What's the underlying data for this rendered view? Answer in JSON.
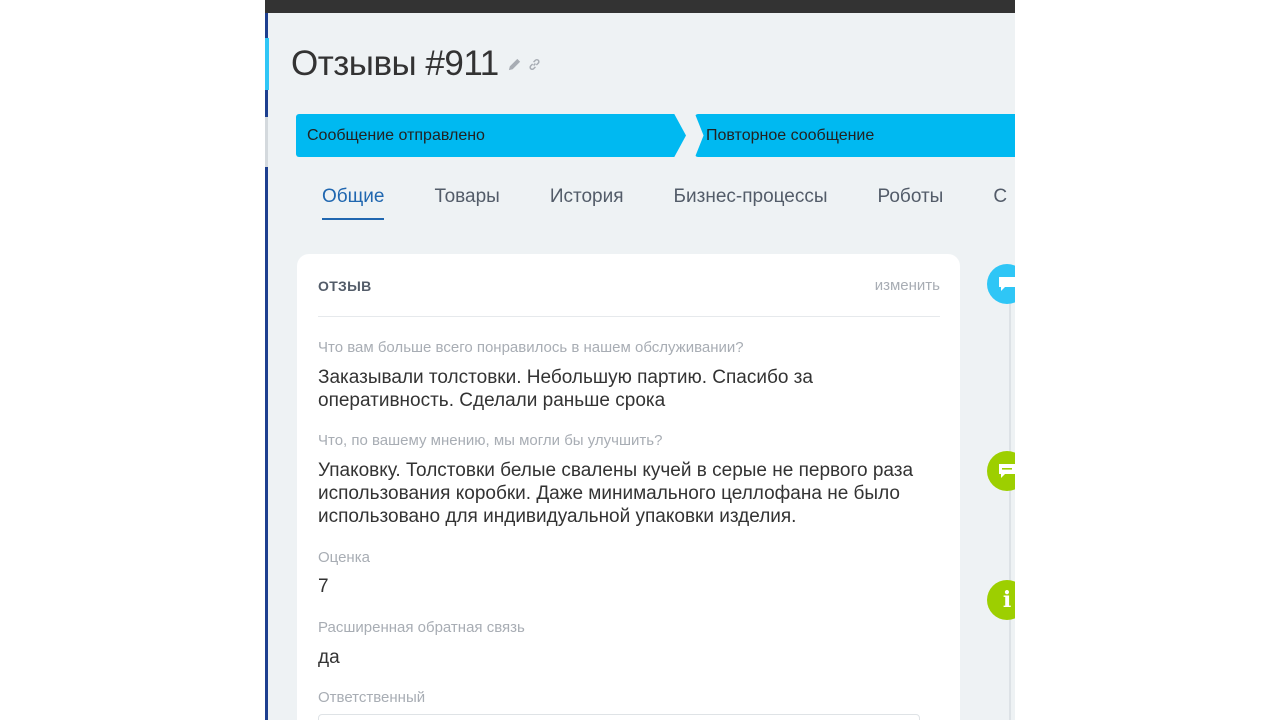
{
  "page": {
    "title": "Отзывы #911"
  },
  "stages": [
    {
      "label": "Сообщение отправлено"
    },
    {
      "label": "Повторное сообщение"
    }
  ],
  "tabs": [
    {
      "label": "Общие",
      "active": true
    },
    {
      "label": "Товары",
      "active": false
    },
    {
      "label": "История",
      "active": false
    },
    {
      "label": "Бизнес-процессы",
      "active": false
    },
    {
      "label": "Роботы",
      "active": false
    },
    {
      "label": "С",
      "active": false
    }
  ],
  "card": {
    "header": "ОТЗЫВ",
    "edit_label": "изменить",
    "fields": [
      {
        "label": "Что вам больше всего понравилось в нашем обслуживании?",
        "value": "Заказывали толстовки. Небольшую партию. Спасибо за оперативность. Сделали раньше срока"
      },
      {
        "label": "Что, по вашему мнению, мы могли бы улучшить?",
        "value": "Упаковку. Толстовки белые свалены кучей в серые не первого раза использования коробки. Даже минимального целлофана не было использовано для индивидуальной упаковки изделия."
      },
      {
        "label": "Оценка",
        "value": "7"
      },
      {
        "label": "Расширенная обратная связь",
        "value": "да"
      },
      {
        "label": "Ответственный",
        "value": ""
      }
    ]
  },
  "timeline": {
    "icons": [
      "comment-icon",
      "chat-icon",
      "info-icon"
    ],
    "info_glyph": "i"
  },
  "colors": {
    "stage": "#00b9f1",
    "accent_blue": "#2067b0",
    "timeline_blue": "#2fc6f6",
    "timeline_green": "#9dcf00"
  }
}
